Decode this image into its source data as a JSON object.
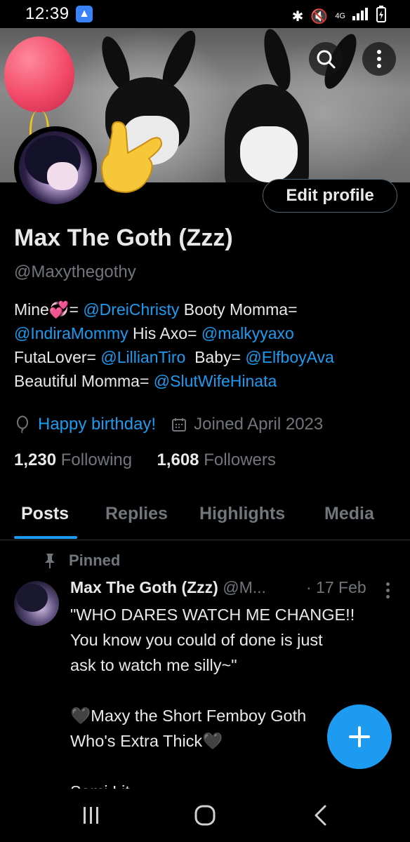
{
  "status_bar": {
    "time": "12:39",
    "right_icons": [
      "bluetooth-icon",
      "mute-icon",
      "4g-icon",
      "signal-icon",
      "battery-icon"
    ],
    "network_label": "4G"
  },
  "header": {
    "search_icon": "search-icon",
    "more_icon": "more-vertical-icon"
  },
  "profile": {
    "edit_button_label": "Edit profile",
    "display_name": "Max The Goth (Zzz)",
    "handle": "@Maxythegothy",
    "bio": {
      "line1": [
        {
          "text": "Mine",
          "type": "text"
        },
        {
          "text": "💞",
          "type": "emoji"
        },
        {
          "text": "= ",
          "type": "text"
        },
        {
          "text": "@DreiChristy",
          "type": "mention"
        },
        {
          "text": " Booty Momma=",
          "type": "text"
        }
      ],
      "line2": [
        {
          "text": "@IndiraMommy",
          "type": "mention"
        },
        {
          "text": " His Axo= ",
          "type": "text"
        },
        {
          "text": "@malkyyaxo",
          "type": "mention"
        }
      ],
      "line3": [
        {
          "text": "FutaLover= ",
          "type": "text"
        },
        {
          "text": "@LillianTiro",
          "type": "mention"
        },
        {
          "text": "  Baby= ",
          "type": "text"
        },
        {
          "text": "@ElfboyAva",
          "type": "mention"
        }
      ],
      "line4": [
        {
          "text": "Beautiful Momma= ",
          "type": "text"
        },
        {
          "text": "@SlutWifeHinata",
          "type": "mention"
        }
      ]
    },
    "birthday_text": "Happy birthday!",
    "joined_text": "Joined April 2023",
    "following_count": "1,230",
    "following_label": "Following",
    "followers_count": "1,608",
    "followers_label": "Followers"
  },
  "tabs": [
    {
      "label": "Posts",
      "active": true
    },
    {
      "label": "Replies",
      "active": false
    },
    {
      "label": "Highlights",
      "active": false
    },
    {
      "label": "Media",
      "active": false
    }
  ],
  "pinned_post": {
    "pinned_label": "Pinned",
    "author": "Max The Goth (Zzz)",
    "handle": "@M...",
    "date": "· 17 Feb",
    "lines": [
      "\"WHO DARES WATCH ME CHANGE!!",
      "You know you could of done is just",
      "ask to watch me silly~\"",
      "",
      "🖤Maxy the Short Femboy Goth",
      "Who's Extra Thick🖤",
      "",
      "Semi Lit"
    ]
  },
  "fab_icon": "plus-icon",
  "nav": {
    "recents_icon": "recents-icon",
    "home_icon": "home-icon",
    "back_icon": "back-icon"
  },
  "colors": {
    "accent": "#1d9bf0",
    "background": "#000000",
    "text_primary": "#e7e9ea",
    "text_secondary": "#71767b"
  }
}
